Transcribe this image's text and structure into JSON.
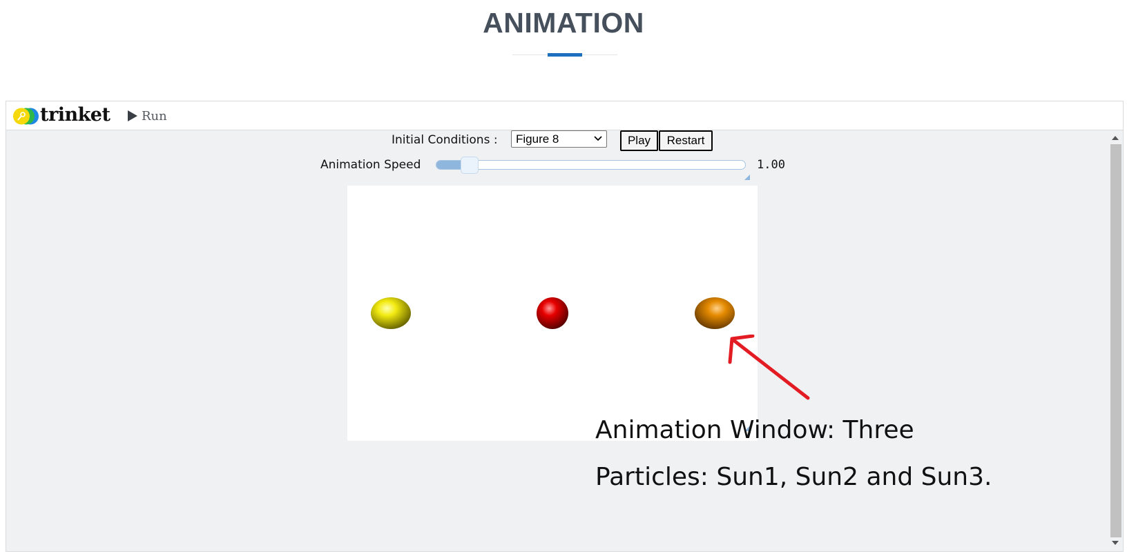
{
  "page": {
    "title": "ANIMATION"
  },
  "toolbar": {
    "logo_text": "trinket",
    "run_label": "Run"
  },
  "controls": {
    "initial_conditions_label": "Initial Conditions :",
    "initial_conditions_value": "Figure 8",
    "play_label": "Play",
    "restart_label": "Restart",
    "speed_label": "Animation Speed",
    "speed_value": "1.00",
    "speed_fraction": 0.08
  },
  "canvas": {
    "particles": [
      {
        "name": "particle-sun1",
        "color": "#e6d800"
      },
      {
        "name": "particle-sun2",
        "color": "#e00000"
      },
      {
        "name": "particle-sun3",
        "color": "#e08400"
      }
    ]
  },
  "annotation": {
    "line1": "Animation Window: Three",
    "line2": "Particles: Sun1, Sun2 and Sun3.",
    "color": "#e31b23"
  },
  "colors": {
    "accent": "#1f6fbf",
    "logo_yellow": "#f5d90a",
    "logo_green": "#2eb84a",
    "logo_blue": "#1e88e5"
  }
}
